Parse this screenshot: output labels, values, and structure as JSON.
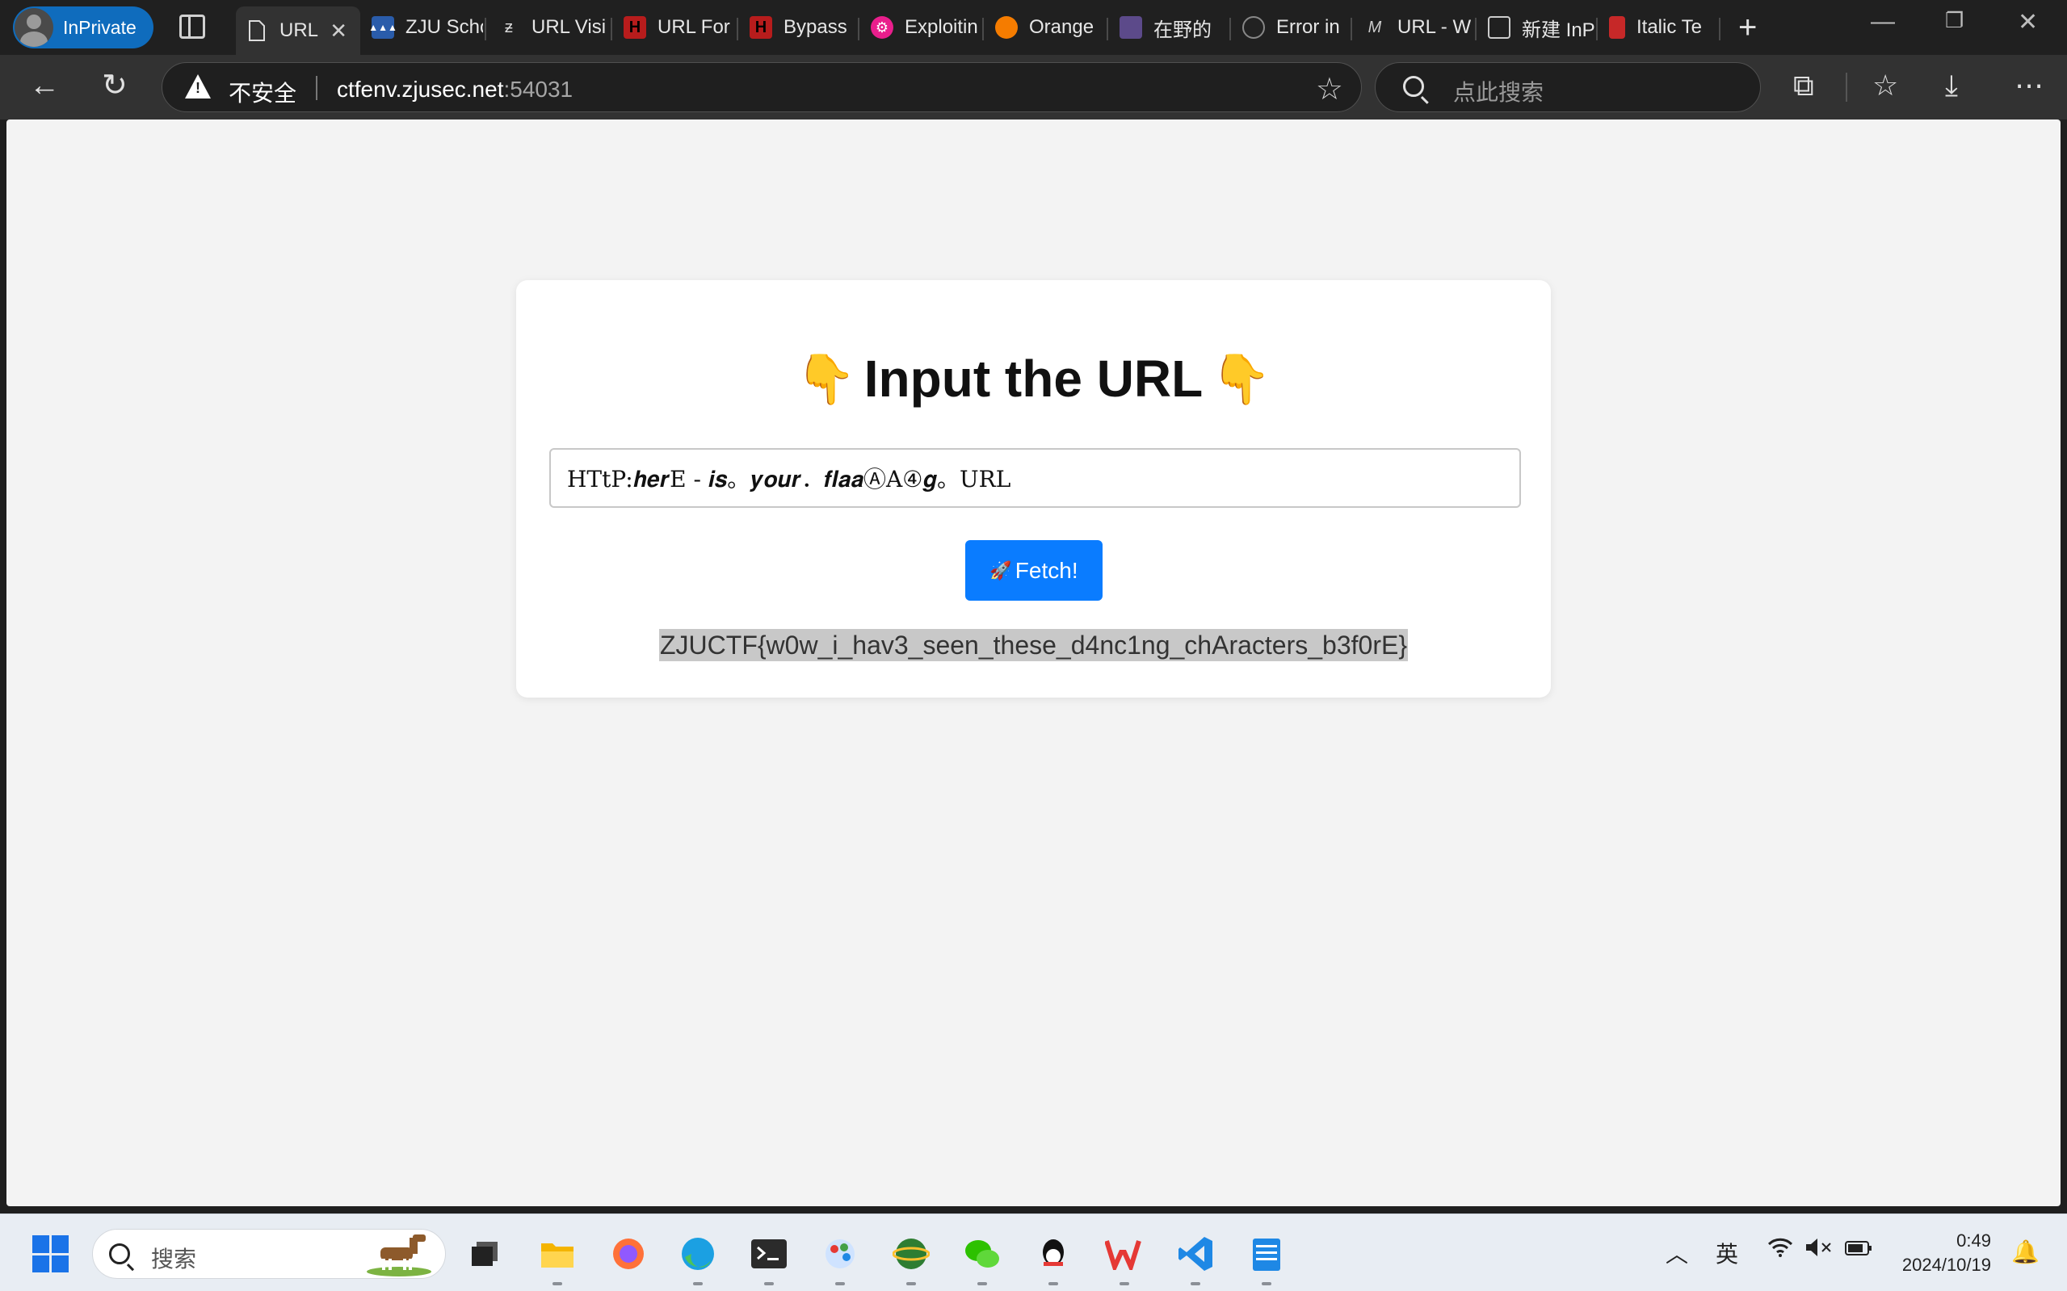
{
  "browser": {
    "inprivate_label": "InPrivate",
    "tabs": [
      {
        "title": "URL",
        "icon": "page-icon",
        "active": true
      },
      {
        "title": "ZJU School",
        "icon": "zju-icon"
      },
      {
        "title": "URL Visi",
        "icon": "z-icon"
      },
      {
        "title": "URL For",
        "icon": "red-h-icon"
      },
      {
        "title": "Bypass",
        "icon": "red-h-icon"
      },
      {
        "title": "Exploitin",
        "icon": "magenta-gear-icon"
      },
      {
        "title": "Orange",
        "icon": "orange-icon"
      },
      {
        "title": "在野的",
        "icon": "anime-icon"
      },
      {
        "title": "Error in",
        "icon": "github-icon"
      },
      {
        "title": "URL - W",
        "icon": "m-icon"
      },
      {
        "title": "新建 InP",
        "icon": "newtab-page-icon"
      },
      {
        "title": "Italic Te",
        "icon": "red-book-icon"
      }
    ],
    "security_label": "不安全",
    "url_host": "ctfenv.zjusec.net",
    "url_port": ":54031",
    "search_placeholder": "点此搜索"
  },
  "page": {
    "heading": "Input the URL",
    "heading_emoji": "👇",
    "url_input_value": "HTtP:𝒉𝒆𝒓E - 𝒊𝒔。𝒚𝒐𝒖𝒓．𝒇𝒍𝒂𝒂ⒶA④𝒈。URL",
    "fetch_emoji": "🚀",
    "fetch_label": "Fetch!",
    "result_flag": "ZJUCTF{w0w_i_hav3_seen_these_d4nc1ng_chAracters_b3f0rE}"
  },
  "taskbar": {
    "search_placeholder": "搜索",
    "apps": [
      "task-view-icon",
      "file-explorer-icon",
      "firefox-icon",
      "edge-icon",
      "terminal-icon",
      "paint-icon",
      "network-icon",
      "wechat-icon",
      "qq-icon",
      "wps-icon",
      "vscode-icon",
      "notepad-icon"
    ],
    "ime_label": "英",
    "time": "0:49",
    "date": "2024/10/19"
  },
  "colors": {
    "accent": "#0a7cff",
    "inprivate": "#0f6cbd",
    "page_bg": "#f3f3f3",
    "flag_highlight": "#c8c8c8"
  }
}
